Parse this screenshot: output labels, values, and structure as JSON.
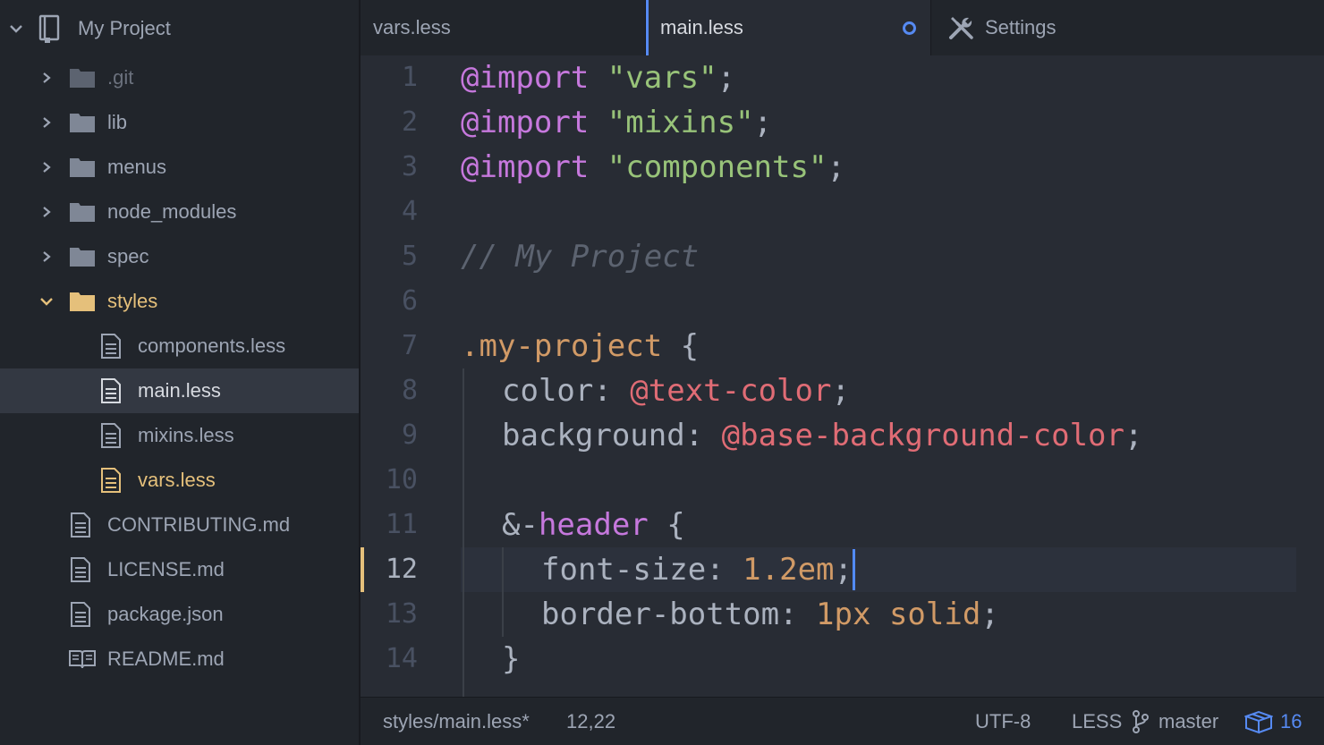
{
  "sidebar": {
    "project_name": "My Project",
    "items": [
      {
        "label": ".git",
        "type": "folder",
        "state": "collapsed"
      },
      {
        "label": "lib",
        "type": "folder",
        "state": "collapsed"
      },
      {
        "label": "menus",
        "type": "folder",
        "state": "collapsed"
      },
      {
        "label": "node_modules",
        "type": "folder",
        "state": "collapsed"
      },
      {
        "label": "spec",
        "type": "folder",
        "state": "collapsed"
      },
      {
        "label": "styles",
        "type": "folder",
        "state": "expanded"
      },
      {
        "label": "components.less",
        "type": "file"
      },
      {
        "label": "main.less",
        "type": "file",
        "selected": true
      },
      {
        "label": "mixins.less",
        "type": "file"
      },
      {
        "label": "vars.less",
        "type": "file",
        "modified": true
      },
      {
        "label": "CONTRIBUTING.md",
        "type": "file"
      },
      {
        "label": "LICENSE.md",
        "type": "file"
      },
      {
        "label": "package.json",
        "type": "file"
      },
      {
        "label": "README.md",
        "type": "book"
      }
    ]
  },
  "tabs": [
    {
      "label": "vars.less",
      "active": false
    },
    {
      "label": "main.less",
      "active": true,
      "modified": true
    },
    {
      "label": "Settings",
      "icon": "tools-icon",
      "active": false
    }
  ],
  "editor": {
    "current_line": "12",
    "line_numbers": [
      "1",
      "2",
      "3",
      "4",
      "5",
      "6",
      "7",
      "8",
      "9",
      "10",
      "11",
      "12",
      "13",
      "14"
    ],
    "code": {
      "l1": {
        "kw": "@import",
        "sp": " ",
        "str": "\"vars\"",
        "pun": ";"
      },
      "l2": {
        "kw": "@import",
        "sp": " ",
        "str": "\"mixins\"",
        "pun": ";"
      },
      "l3": {
        "kw": "@import",
        "sp": " ",
        "str": "\"components\"",
        "pun": ";"
      },
      "l5": {
        "comment": "// My Project"
      },
      "l7": {
        "selector": ".my-project",
        "brace": " {"
      },
      "l8": {
        "prop": "color: ",
        "var": "@text-color",
        "pun": ";"
      },
      "l9": {
        "prop": "background: ",
        "var": "@base-background-color",
        "pun": ";"
      },
      "l11": {
        "amp": "&-",
        "kw": "header",
        "brace": " {"
      },
      "l12": {
        "prop": "font-size: ",
        "num": "1.2em",
        "pun": ";"
      },
      "l13": {
        "prop": "border-bottom: ",
        "num": "1px",
        "sp": " ",
        "val": "solid",
        "pun": ";"
      },
      "l14": {
        "brace": "}"
      }
    }
  },
  "statusbar": {
    "file_path": "styles/main.less*",
    "cursor_position": "12,22",
    "encoding": "UTF-8",
    "grammar": "LESS",
    "branch": "master",
    "updates_count": "16"
  },
  "colors": {
    "accent": "#568af2",
    "modified": "#e5c07b",
    "background": "#282c34",
    "panel": "#21252b"
  }
}
